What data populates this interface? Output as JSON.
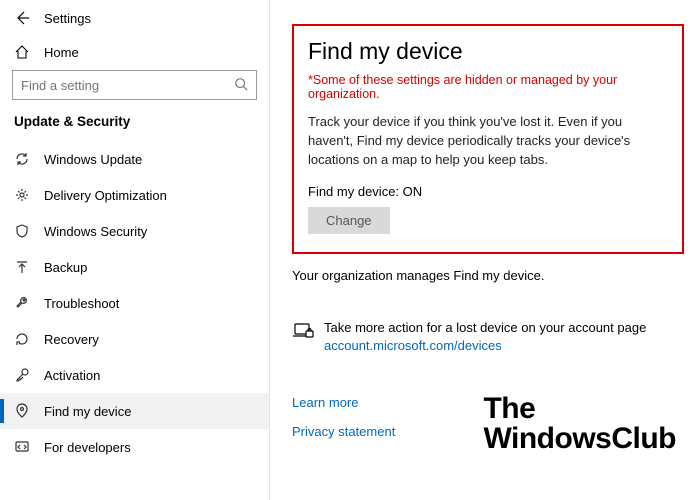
{
  "header": {
    "settings_label": "Settings",
    "home_label": "Home",
    "search_placeholder": "Find a setting",
    "category_label": "Update & Security"
  },
  "sidebar": {
    "items": [
      {
        "label": "Windows Update"
      },
      {
        "label": "Delivery Optimization"
      },
      {
        "label": "Windows Security"
      },
      {
        "label": "Backup"
      },
      {
        "label": "Troubleshoot"
      },
      {
        "label": "Recovery"
      },
      {
        "label": "Activation"
      },
      {
        "label": "Find my device"
      },
      {
        "label": "For developers"
      }
    ]
  },
  "main": {
    "title": "Find my device",
    "managed_notice": "*Some of these settings are hidden or managed by your organization.",
    "description": "Track your device if you think you've lost it. Even if you haven't, Find my device periodically tracks your device's locations on a map to help you keep tabs.",
    "status_label": "Find my device: ON",
    "change_button": "Change",
    "org_manages": "Your organization manages Find my device.",
    "more_action_text": "Take more action for a lost device on your account page",
    "more_action_link": "account.microsoft.com/devices",
    "learn_more": "Learn more",
    "privacy": "Privacy statement"
  },
  "watermark": {
    "line1": "The",
    "line2": "WindowsClub"
  }
}
